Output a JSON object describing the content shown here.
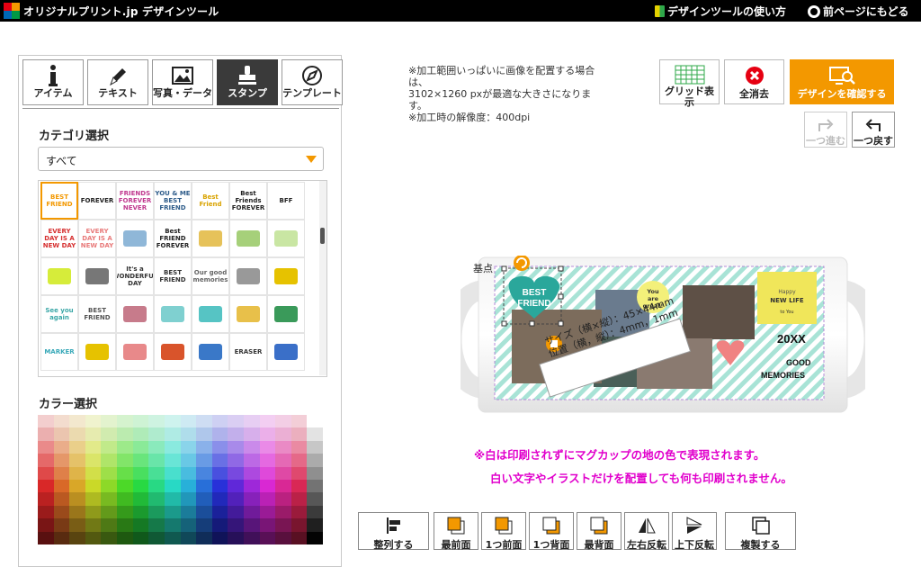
{
  "header": {
    "logo_text": "オリジナルプリント.jp デザインツール",
    "help_link": "デザインツールの使い方",
    "back_link": "前ページにもどる"
  },
  "tabs": [
    {
      "label": "アイテム",
      "icon": "info-icon"
    },
    {
      "label": "テキスト",
      "icon": "pen-icon"
    },
    {
      "label": "写真・データ",
      "icon": "image-icon"
    },
    {
      "label": "スタンプ",
      "icon": "stamp-icon",
      "active": true
    },
    {
      "label": "テンプレート",
      "icon": "compass-icon"
    }
  ],
  "category": {
    "title": "カテゴリ選択",
    "selected": "すべて"
  },
  "stamps": [
    {
      "text": "BEST FRIEND",
      "color": "#f39800"
    },
    {
      "text": "FOREVER",
      "color": "#222222"
    },
    {
      "text": "FRIENDS FOREVER NEVER",
      "color": "#c0398f"
    },
    {
      "text": "YOU & ME BEST FRIEND",
      "color": "#2e5c8a"
    },
    {
      "text": "Best Friend",
      "color": "#d9a300"
    },
    {
      "text": "Best Friends FOREVER",
      "color": "#222222"
    },
    {
      "text": "BFF",
      "color": "#222222"
    },
    {
      "text": "EVERY DAY IS A NEW DAY",
      "color": "#d62f2f"
    },
    {
      "text": "EVERY DAY IS A NEW DAY",
      "color": "#e87a7a"
    },
    {
      "text": "",
      "color": "#8fb7d8"
    },
    {
      "text": "Best FRIEND FOREVER",
      "color": "#222222"
    },
    {
      "text": "",
      "color": "#e6c25a"
    },
    {
      "text": "",
      "color": "#a6d07a"
    },
    {
      "text": "",
      "color": "#c9e6a3"
    },
    {
      "text": "",
      "color": "#d6ec3a"
    },
    {
      "text": "",
      "color": "#777777"
    },
    {
      "text": "It's a WONDERFUL DAY",
      "color": "#333333"
    },
    {
      "text": "BEST FRIEND",
      "color": "#333333"
    },
    {
      "text": "Our good memories",
      "color": "#666666"
    },
    {
      "text": "",
      "color": "#999999"
    },
    {
      "text": "",
      "color": "#e6c200"
    },
    {
      "text": "See you again",
      "color": "#3aa7a7"
    },
    {
      "text": "BEST FRIEND",
      "color": "#555555"
    },
    {
      "text": "",
      "color": "#c77b8b"
    },
    {
      "text": "",
      "color": "#7fd0d0"
    },
    {
      "text": "",
      "color": "#56c4c4"
    },
    {
      "text": "",
      "color": "#e8c04a"
    },
    {
      "text": "",
      "color": "#3a9a5a"
    },
    {
      "text": "MARKER",
      "color": "#37a8b8"
    },
    {
      "text": "",
      "color": "#e6c200"
    },
    {
      "text": "",
      "color": "#e8898a"
    },
    {
      "text": "",
      "color": "#d9542b"
    },
    {
      "text": "",
      "color": "#3a78c8"
    },
    {
      "text": "ERASER",
      "color": "#333333"
    },
    {
      "text": "",
      "color": "#3a6fc8"
    }
  ],
  "color_select": {
    "title": "カラー選択"
  },
  "info_text": {
    "line1": "※加工範囲いっぱいに画像を配置する場合は、",
    "line2": "3102×1260 pxが最適な大きさになります。",
    "line3": "※加工時の解像度：400dpi"
  },
  "toolbar": {
    "grid_label": "グリッド表示",
    "clear_label": "全消去",
    "confirm_label": "デザインを確認する",
    "redo_label": "一つ進む",
    "undo_label": "一つ戻す"
  },
  "canvas": {
    "anchor_label": "基点",
    "size_label": "サイズ（横×縦）：45×44mm",
    "position_label": "位置（横，縦）：4mm，1mm",
    "stamp_best_friend": "BEST FRIEND",
    "stamp_you_are_great": "You are great!",
    "stamp_happy": "Happy NEW LIFE",
    "stamp_20xx": "20XX",
    "stamp_memories": "GOOD MEMORIES"
  },
  "notice": {
    "line1": "※白は印刷されずにマグカップの地の色で表現されます。",
    "line2": "白い文字やイラストだけを配置しても何も印刷されません。"
  },
  "bottom_toolbar": [
    {
      "label": "整列する",
      "name": "align-button"
    },
    {
      "label": "最前面",
      "name": "bring-to-front-button"
    },
    {
      "label": "1つ前面",
      "name": "bring-forward-button"
    },
    {
      "label": "1つ背面",
      "name": "send-backward-button"
    },
    {
      "label": "最背面",
      "name": "send-to-back-button"
    },
    {
      "label": "左右反転",
      "name": "flip-horizontal-button"
    },
    {
      "label": "上下反転",
      "name": "flip-vertical-button"
    },
    {
      "label": "複製する",
      "name": "duplicate-button"
    }
  ],
  "colors": {
    "accent": "#f39800",
    "notice": "#e100cc",
    "active_tab": "#3a3a3a",
    "clear_red": "#e60012"
  }
}
